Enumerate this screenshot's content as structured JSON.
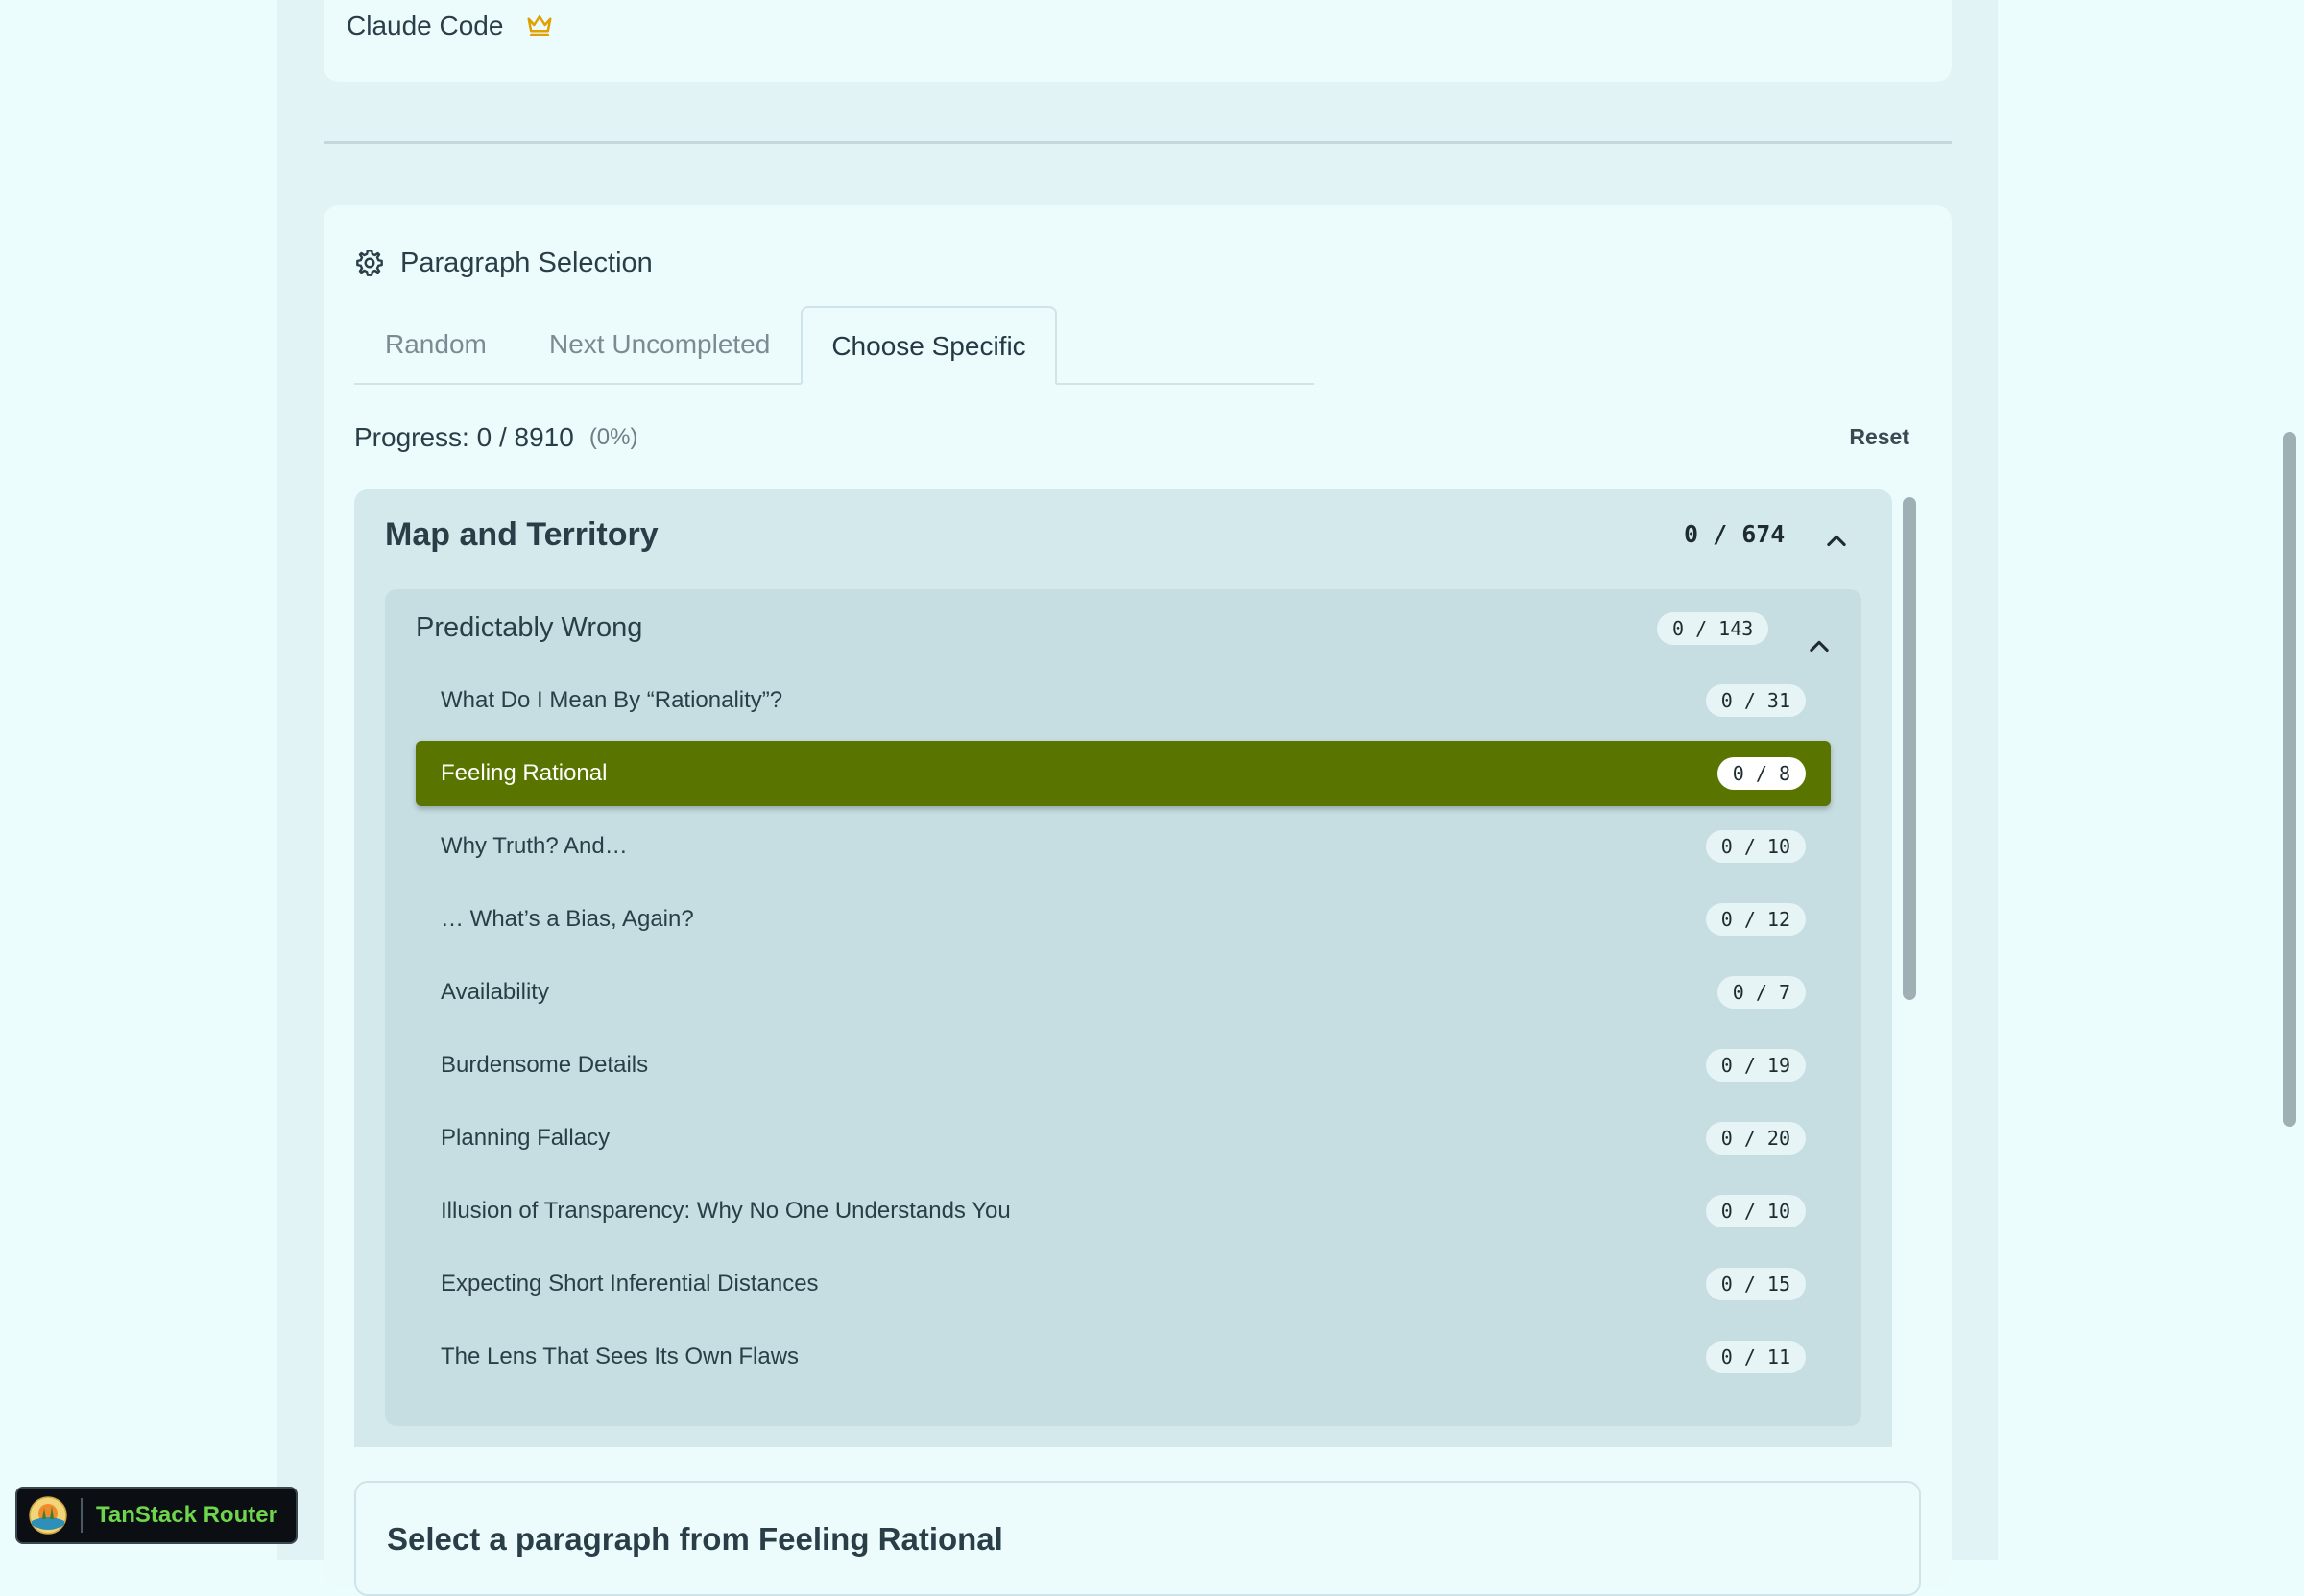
{
  "model": {
    "name": "Claude Code",
    "icon": "crown-icon"
  },
  "section": {
    "title": "Paragraph Selection",
    "icon": "gear-icon"
  },
  "tabs": [
    {
      "label": "Random",
      "active": false
    },
    {
      "label": "Next Uncompleted",
      "active": false
    },
    {
      "label": "Choose Specific",
      "active": true
    }
  ],
  "progress": {
    "text": "Progress: 0 / 8910",
    "percent": "(0%)",
    "reset_label": "Reset"
  },
  "book": {
    "title": "Map and Territory",
    "count": "0 / 674",
    "sequence": {
      "title": "Predictably Wrong",
      "count": "0 / 143",
      "items": [
        {
          "label": "What Do I Mean By “Rationality”?",
          "count": "0 / 31"
        },
        {
          "label": "Feeling Rational",
          "count": "0 / 8"
        },
        {
          "label": "Why Truth? And…",
          "count": "0 / 10"
        },
        {
          "label": "… What’s a Bias, Again?",
          "count": "0 / 12"
        },
        {
          "label": "Availability",
          "count": "0 / 7"
        },
        {
          "label": "Burdensome Details",
          "count": "0 / 19"
        },
        {
          "label": "Planning Fallacy",
          "count": "0 / 20"
        },
        {
          "label": "Illusion of Transparency: Why No One Understands You",
          "count": "0 / 10"
        },
        {
          "label": "Expecting Short Inferential Distances",
          "count": "0 / 15"
        },
        {
          "label": "The Lens That Sees Its Own Flaws",
          "count": "0 / 11"
        }
      ],
      "selected_index": 1
    }
  },
  "paragraph_panel": {
    "title": "Select a paragraph from Feeling Rational"
  },
  "devtools": {
    "label": "TanStack Router"
  },
  "colors": {
    "selected": "#5a7400",
    "accent_text": "#6fd64b",
    "crown": "#e0a000"
  }
}
